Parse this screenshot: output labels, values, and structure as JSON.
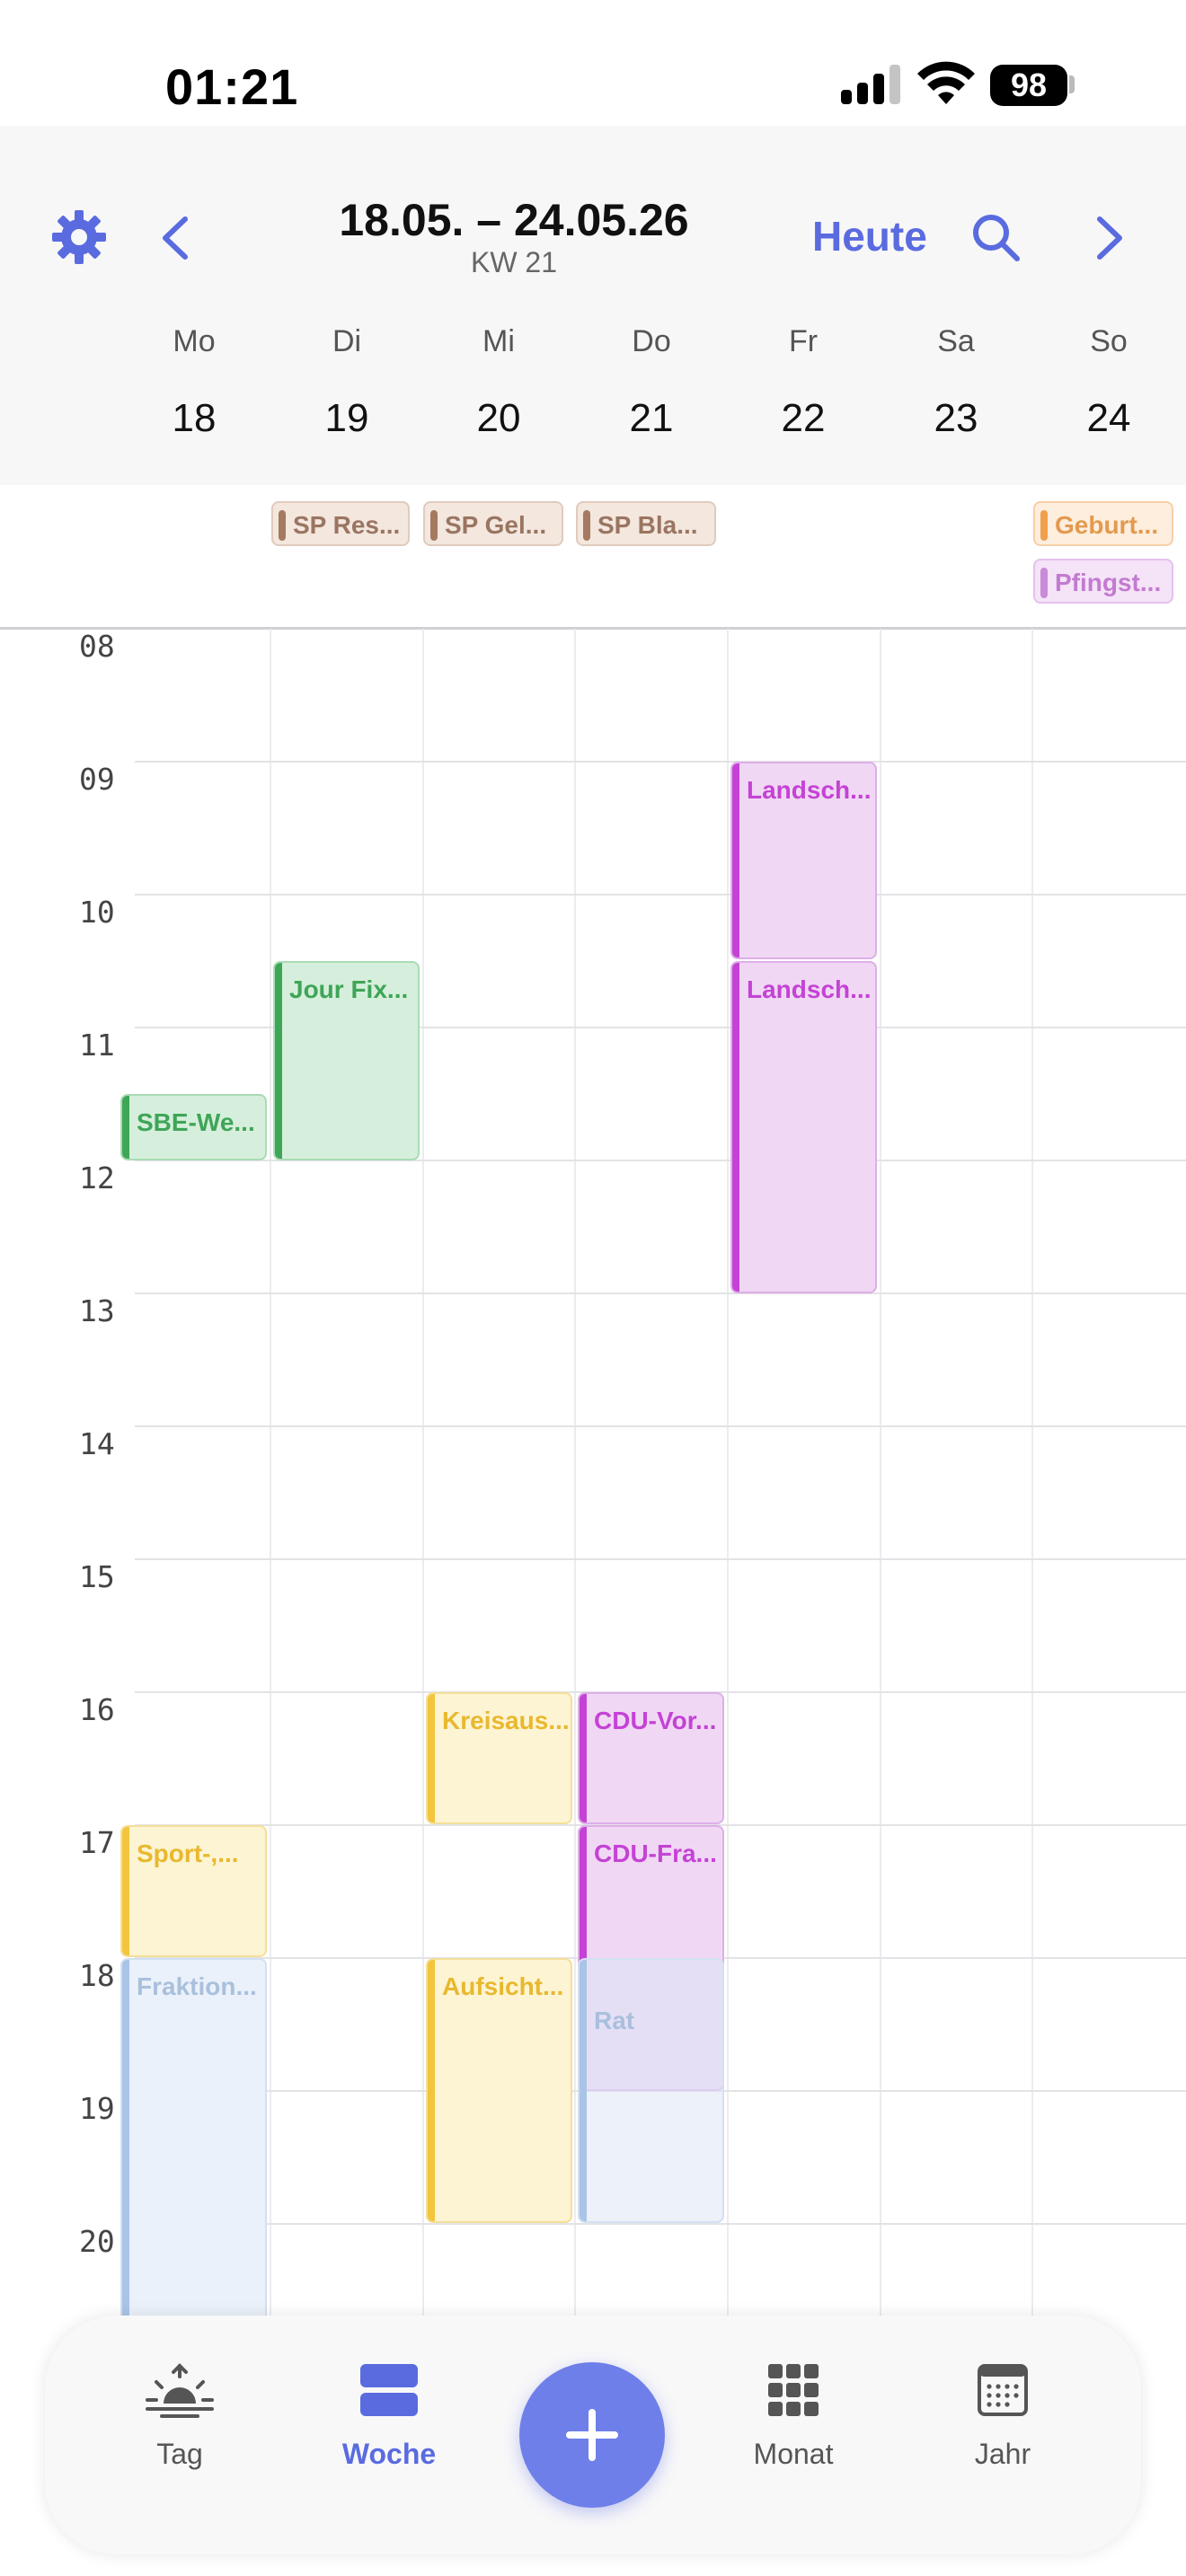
{
  "status_bar": {
    "time": "01:21",
    "battery": "98"
  },
  "header": {
    "date_range": "18.05. – 24.05.26",
    "week": "KW 21",
    "today_label": "Heute"
  },
  "days": [
    {
      "name": "Mo",
      "date": "18"
    },
    {
      "name": "Di",
      "date": "19"
    },
    {
      "name": "Mi",
      "date": "20"
    },
    {
      "name": "Do",
      "date": "21"
    },
    {
      "name": "Fr",
      "date": "22"
    },
    {
      "name": "Sa",
      "date": "23"
    },
    {
      "name": "So",
      "date": "24"
    }
  ],
  "all_day_events": [
    {
      "label": "SP Res...",
      "day": "Di"
    },
    {
      "label": "SP Gel...",
      "day": "Mi"
    },
    {
      "label": "SP Bla...",
      "day": "Do"
    },
    {
      "label": "Geburt...",
      "day": "So"
    },
    {
      "label": "Pfingst...",
      "day": "So"
    }
  ],
  "hours": [
    "08",
    "09",
    "10",
    "11",
    "12",
    "13",
    "14",
    "15",
    "16",
    "17",
    "18",
    "19",
    "20"
  ],
  "events": [
    {
      "label": "Landsch...",
      "day": "Fr",
      "start": "09:00",
      "end": "10:30"
    },
    {
      "label": "Landsch...",
      "day": "Fr",
      "start": "10:30",
      "end": "13:00"
    },
    {
      "label": "Jour Fix...",
      "day": "Di",
      "start": "10:30",
      "end": "12:00"
    },
    {
      "label": "SBE-We...",
      "day": "Mo",
      "start": "11:30",
      "end": "12:00"
    },
    {
      "label": "Kreisaus...",
      "day": "Mi",
      "start": "16:00",
      "end": "17:00"
    },
    {
      "label": "CDU-Vor...",
      "day": "Do",
      "start": "16:00",
      "end": "17:00"
    },
    {
      "label": "Sport-,...",
      "day": "Mo",
      "start": "17:00",
      "end": "18:00"
    },
    {
      "label": "CDU-Fra...",
      "day": "Do",
      "start": "17:00",
      "end": "19:00"
    },
    {
      "label": "Fraktion...",
      "day": "Mo",
      "start": "18:00",
      "end": "20:45"
    },
    {
      "label": "Aufsicht...",
      "day": "Mi",
      "start": "18:00",
      "end": "20:00"
    },
    {
      "label": "Rat",
      "day": "Do",
      "start": "18:00",
      "end": "20:00"
    }
  ],
  "colors": {
    "accent": "#5a6be0",
    "green": "#3fa557",
    "purple": "#c443d4",
    "yellow": "#f2c53d",
    "brown": "#a57a60",
    "orange": "#f0a04a",
    "light_blue": "#a9c4e6"
  },
  "tabbar": {
    "tag": "Tag",
    "woche": "Woche",
    "monat": "Monat",
    "jahr": "Jahr"
  }
}
